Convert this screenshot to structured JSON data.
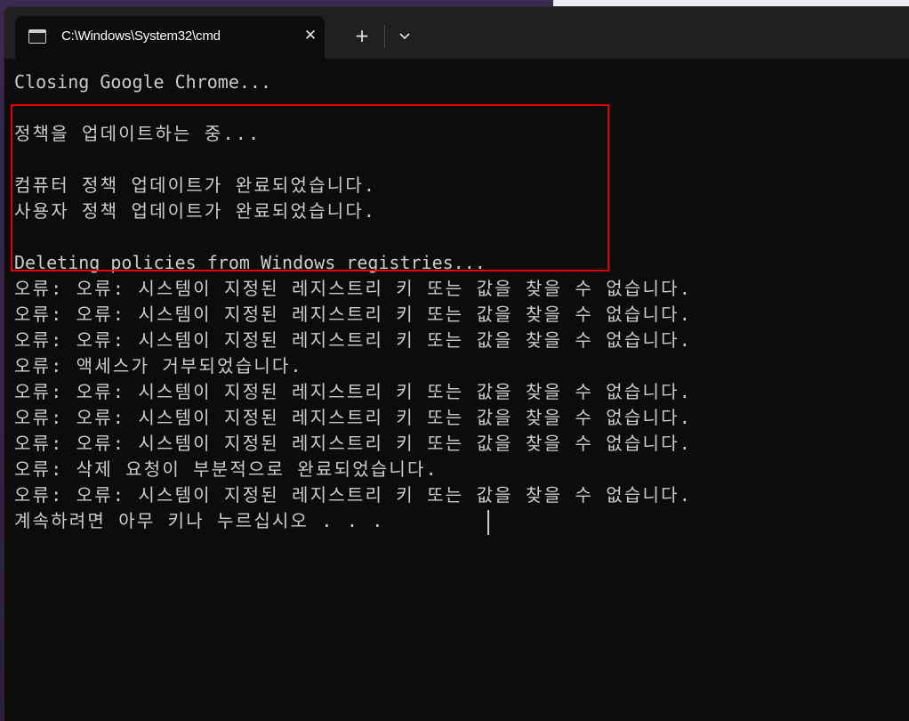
{
  "window": {
    "tab_title": "C:\\Windows\\System32\\cmd",
    "close_glyph": "✕",
    "new_tab_glyph": "+",
    "icons": {
      "tab": "terminal-icon",
      "close": "close-icon",
      "new_tab": "plus-icon",
      "dropdown": "chevron-down-icon"
    }
  },
  "console": {
    "lines": [
      "Closing Google Chrome...",
      "정책을 업데이트하는 중...",
      "",
      "컴퓨터 정책 업데이트가 완료되었습니다.",
      "사용자 정책 업데이트가 완료되었습니다.",
      "",
      "Deleting policies from Windows registries...",
      "오류: 오류: 시스템이 지정된 레지스트리 키 또는 값을 찾을 수 없습니다.",
      "오류: 오류: 시스템이 지정된 레지스트리 키 또는 값을 찾을 수 없습니다.",
      "오류: 오류: 시스템이 지정된 레지스트리 키 또는 값을 찾을 수 없습니다.",
      "오류: 액세스가 거부되었습니다.",
      "오류: 오류: 시스템이 지정된 레지스트리 키 또는 값을 찾을 수 없습니다.",
      "오류: 오류: 시스템이 지정된 레지스트리 키 또는 값을 찾을 수 없습니다.",
      "오류: 오류: 시스템이 지정된 레지스트리 키 또는 값을 찾을 수 없습니다.",
      "오류: 삭제 요청이 부분적으로 완료되었습니다.",
      "오류: 오류: 시스템이 지정된 레지스트리 키 또는 값을 찾을 수 없습니다.",
      "계속하려면 아무 키나 누르십시오 . . ."
    ]
  },
  "colors": {
    "console_bg": "#0c0c0c",
    "console_text": "#cccccc",
    "titlebar": "#202020",
    "highlight": "#e00000"
  }
}
